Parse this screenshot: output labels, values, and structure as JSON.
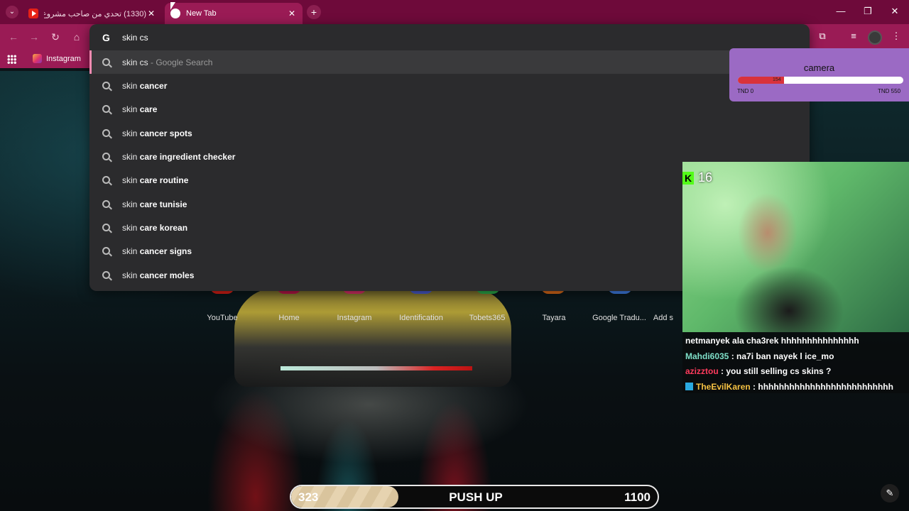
{
  "tabs": [
    {
      "title": "(1330) تحدي من صاحب مشروع إ...",
      "favicon": "youtube-icon",
      "active": false
    },
    {
      "title": "New Tab",
      "favicon": "new-tab-icon",
      "active": true
    }
  ],
  "window_controls": {
    "minimize": "—",
    "restore": "❐",
    "close": "✕"
  },
  "bookmarks": [
    {
      "label": "Instagram",
      "icon": "instagram-icon"
    }
  ],
  "omnibox": {
    "value": "skin cs",
    "suggestions": [
      {
        "prefix": "skin cs",
        "bold": "",
        "hint": " - Google Search"
      },
      {
        "prefix": "skin ",
        "bold": "cancer",
        "hint": ""
      },
      {
        "prefix": "skin ",
        "bold": "care",
        "hint": ""
      },
      {
        "prefix": "skin ",
        "bold": "cancer spots",
        "hint": ""
      },
      {
        "prefix": "skin ",
        "bold": "care ingredient checker",
        "hint": ""
      },
      {
        "prefix": "skin ",
        "bold": "care routine",
        "hint": ""
      },
      {
        "prefix": "skin ",
        "bold": "care tunisie",
        "hint": ""
      },
      {
        "prefix": "skin ",
        "bold": "care korean",
        "hint": ""
      },
      {
        "prefix": "skin ",
        "bold": "cancer signs",
        "hint": ""
      },
      {
        "prefix": "skin ",
        "bold": "cancer moles",
        "hint": ""
      }
    ]
  },
  "shortcuts": [
    "YouTube",
    "Home",
    "Instagram",
    "Identification",
    "Tobets365",
    "Tayara",
    "Google Tradu...",
    "Add s"
  ],
  "camera_goal": {
    "title": "camera",
    "current": "154",
    "current_value": 154,
    "min": "TND 0",
    "max": "TND 550",
    "max_value": 550
  },
  "stream": {
    "viewer_count": "16"
  },
  "chat": [
    {
      "user": "",
      "text": "netmanyek ala cha3rek hhhhhhhhhhhhhhh"
    },
    {
      "user": "Mahdi6035",
      "text": " : na7i ban nayek l ice_mo"
    },
    {
      "user": "azizztou",
      "text": " : you still selling cs skins ?"
    },
    {
      "user": "TheEvilKaren",
      "text": " : hhhhhhhhhhhhhhhhhhhhhhhhhh"
    }
  ],
  "pushup_goal": {
    "current": "323",
    "label": "PUSH UP",
    "target": "1100",
    "progress": 0.2936
  },
  "colors": {
    "tab_bar": "#6e0a3a",
    "toolbar": "#9a1b55",
    "omnibox_bg": "#2b2b2d",
    "camera_widget": "#9b6ac4",
    "goal_fill": "#d9323b"
  }
}
